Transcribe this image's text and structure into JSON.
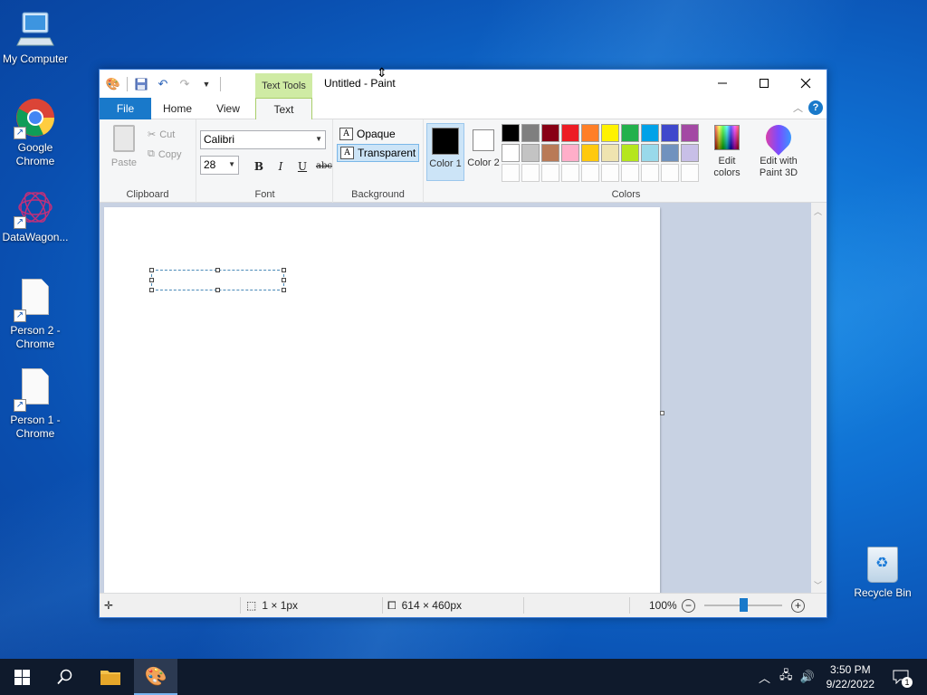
{
  "desktop": {
    "icons": [
      {
        "label": "My Computer"
      },
      {
        "label": "Google Chrome"
      },
      {
        "label": "DataWagon..."
      },
      {
        "label": "Person 2 - Chrome"
      },
      {
        "label": "Person 1 - Chrome"
      },
      {
        "label": "Recycle Bin"
      }
    ]
  },
  "window": {
    "title": "Untitled - Paint",
    "context_tab_header": "Text Tools",
    "tabs": [
      "File",
      "Home",
      "View",
      "Text"
    ],
    "active_tab": "Text"
  },
  "ribbon": {
    "clipboard": {
      "paste": "Paste",
      "cut": "Cut",
      "copy": "Copy",
      "label": "Clipboard"
    },
    "font": {
      "family": "Calibri",
      "size": "28",
      "bold": "B",
      "italic": "I",
      "underline": "U",
      "strike": "abc",
      "label": "Font"
    },
    "background": {
      "opaque": "Opaque",
      "transparent": "Transparent",
      "selected": "Transparent",
      "label": "Background"
    },
    "colors": {
      "color1": "Color 1",
      "color2": "Color 2",
      "color1_value": "#000000",
      "color2_value": "#ffffff",
      "edit_colors": "Edit colors",
      "paint3d": "Edit with Paint 3D",
      "label": "Colors",
      "palette_row1": [
        "#000000",
        "#7f7f7f",
        "#880015",
        "#ed1c24",
        "#ff7f27",
        "#fff200",
        "#22b14c",
        "#00a2e8",
        "#3f48cc",
        "#a349a4"
      ],
      "palette_row2": [
        "#ffffff",
        "#c3c3c3",
        "#b97a57",
        "#ffaec9",
        "#ffc90e",
        "#efe4b0",
        "#b5e61d",
        "#99d9ea",
        "#7092be",
        "#c8bfe7"
      ]
    }
  },
  "status": {
    "selection_size": "1 × 1px",
    "image_size": "614 × 460px",
    "zoom": "100%"
  },
  "taskbar": {
    "time": "3:50 PM",
    "date": "9/22/2022",
    "notification_count": "1"
  }
}
